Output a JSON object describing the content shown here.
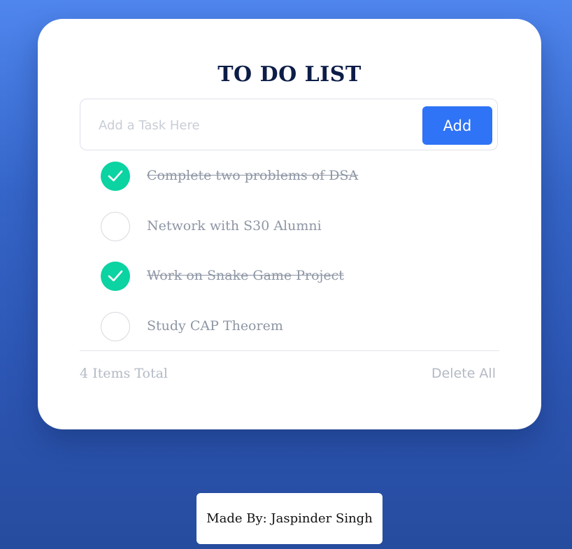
{
  "app": {
    "title": "TO DO LIST"
  },
  "input": {
    "placeholder": "Add a Task Here",
    "value": ""
  },
  "add_button": {
    "label": "Add"
  },
  "tasks": [
    {
      "text": "Complete two problems of DSA",
      "done": true
    },
    {
      "text": "Network with S30 Alumni",
      "done": false
    },
    {
      "text": "Work on Snake Game Project",
      "done": true
    },
    {
      "text": "Study CAP Theorem",
      "done": false
    }
  ],
  "footer": {
    "count_text": "4 Items Total",
    "delete_all_label": "Delete All"
  },
  "credit": {
    "text": "Made By: Jaspinder Singh"
  },
  "colors": {
    "accent": "#2f73f6",
    "done_check": "#0bd3a2",
    "title": "#0c1d47",
    "background": "#3565c8"
  }
}
